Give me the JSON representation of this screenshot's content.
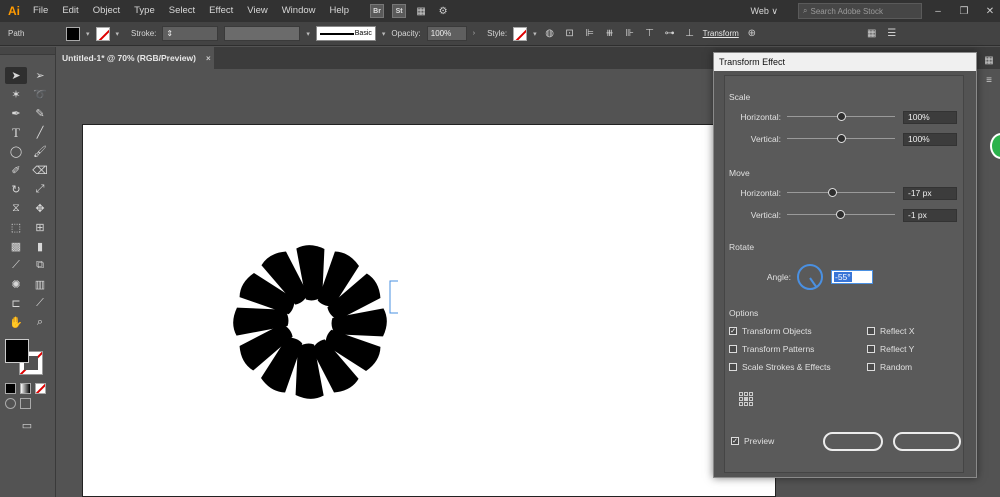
{
  "app": {
    "logo": "Ai"
  },
  "menu": [
    "File",
    "Edit",
    "Object",
    "Type",
    "Select",
    "Effect",
    "View",
    "Window",
    "Help"
  ],
  "menu_icons": [
    "Br",
    "St"
  ],
  "workspace": {
    "label": "Web",
    "caret": "∨"
  },
  "stock_search": {
    "placeholder": "Search Adobe Stock"
  },
  "control": {
    "object_type": "Path",
    "stroke_label": "Stroke:",
    "stroke_style": "Basic",
    "opacity_label": "Opacity:",
    "opacity_value": "100%",
    "style_label": "Style:",
    "transform_label": "Transform"
  },
  "document_tab": {
    "title": "Untitled-1* @ 70% (RGB/Preview)",
    "close": "×"
  },
  "dialog": {
    "title": "Transform Effect",
    "scale": {
      "title": "Scale",
      "horizontal_label": "Horizontal:",
      "horizontal_value": "100%",
      "vertical_label": "Vertical:",
      "vertical_value": "100%"
    },
    "move": {
      "title": "Move",
      "horizontal_label": "Horizontal:",
      "horizontal_value": "-17 px",
      "vertical_label": "Vertical:",
      "vertical_value": "-1 px"
    },
    "rotate": {
      "title": "Rotate",
      "angle_label": "Angle:",
      "angle_value": "-55°"
    },
    "options": {
      "title": "Options",
      "transform_objects": {
        "label": "Transform Objects",
        "checked": true
      },
      "transform_patterns": {
        "label": "Transform Patterns",
        "checked": false
      },
      "scale_strokes": {
        "label": "Scale Strokes & Effects",
        "checked": false
      },
      "reflect_x": {
        "label": "Reflect X",
        "checked": false
      },
      "reflect_y": {
        "label": "Reflect Y",
        "checked": false
      },
      "random": {
        "label": "Random",
        "checked": false
      }
    },
    "preview": {
      "label": "Preview",
      "checked": true
    }
  },
  "colors": {
    "accent": "#4a90e2",
    "brand": "#ff9a00",
    "badge": "#2bb24c"
  }
}
